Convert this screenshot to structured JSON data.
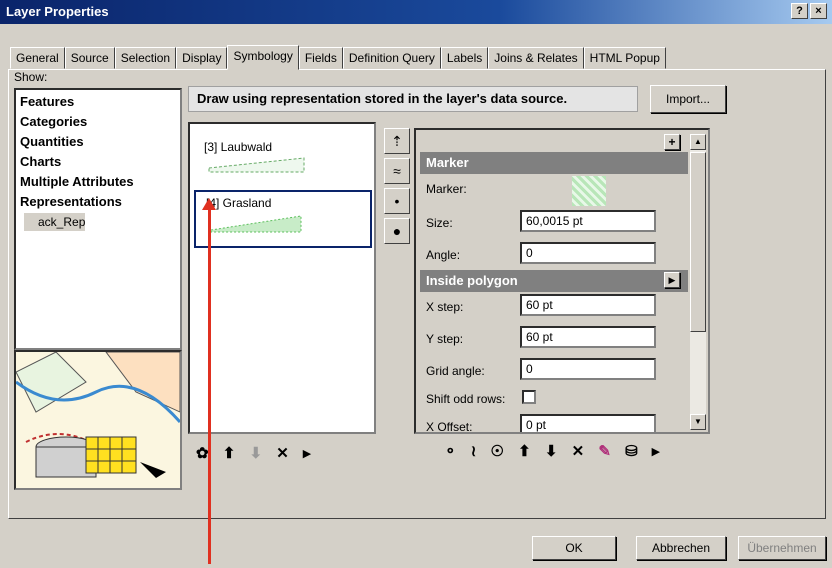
{
  "window": {
    "title": "Layer Properties",
    "help_btn": "?",
    "close_btn": "×"
  },
  "tabs": [
    "General",
    "Source",
    "Selection",
    "Display",
    "Symbology",
    "Fields",
    "Definition Query",
    "Labels",
    "Joins & Relates",
    "HTML Popup"
  ],
  "active_tab": "Symbology",
  "show": {
    "label": "Show:",
    "items": [
      "Features",
      "Categories",
      "Quantities",
      "Charts",
      "Multiple Attributes",
      "Representations"
    ],
    "sub_item": "ack_Rep"
  },
  "info": {
    "text": "Draw using representation stored in the layer's data source.",
    "import_label": "Import..."
  },
  "representations": [
    {
      "label": "[3] Laubwald",
      "selected": false
    },
    {
      "label": "[4] Grasland",
      "selected": true
    }
  ],
  "properties": {
    "marker_section": "Marker",
    "marker_label": "Marker:",
    "size_label": "Size:",
    "size_value": "60,0015 pt",
    "angle_label": "Angle:",
    "angle_value": "0",
    "inside_section": "Inside polygon",
    "xstep_label": "X step:",
    "xstep_value": "60 pt",
    "ystep_label": "Y step:",
    "ystep_value": "60 pt",
    "grid_label": "Grid angle:",
    "grid_value": "0",
    "shift_label": "Shift odd rows:",
    "xoffset_label": "X Offset:",
    "xoffset_value": "0 pt",
    "plus_btn": "+"
  },
  "buttons": {
    "ok": "OK",
    "cancel": "Abbrechen",
    "apply": "Übernehmen"
  },
  "colors": {
    "title_blue": "#0a246a",
    "arrow_red": "#e03020",
    "grass_green": "#5cbf5c"
  }
}
